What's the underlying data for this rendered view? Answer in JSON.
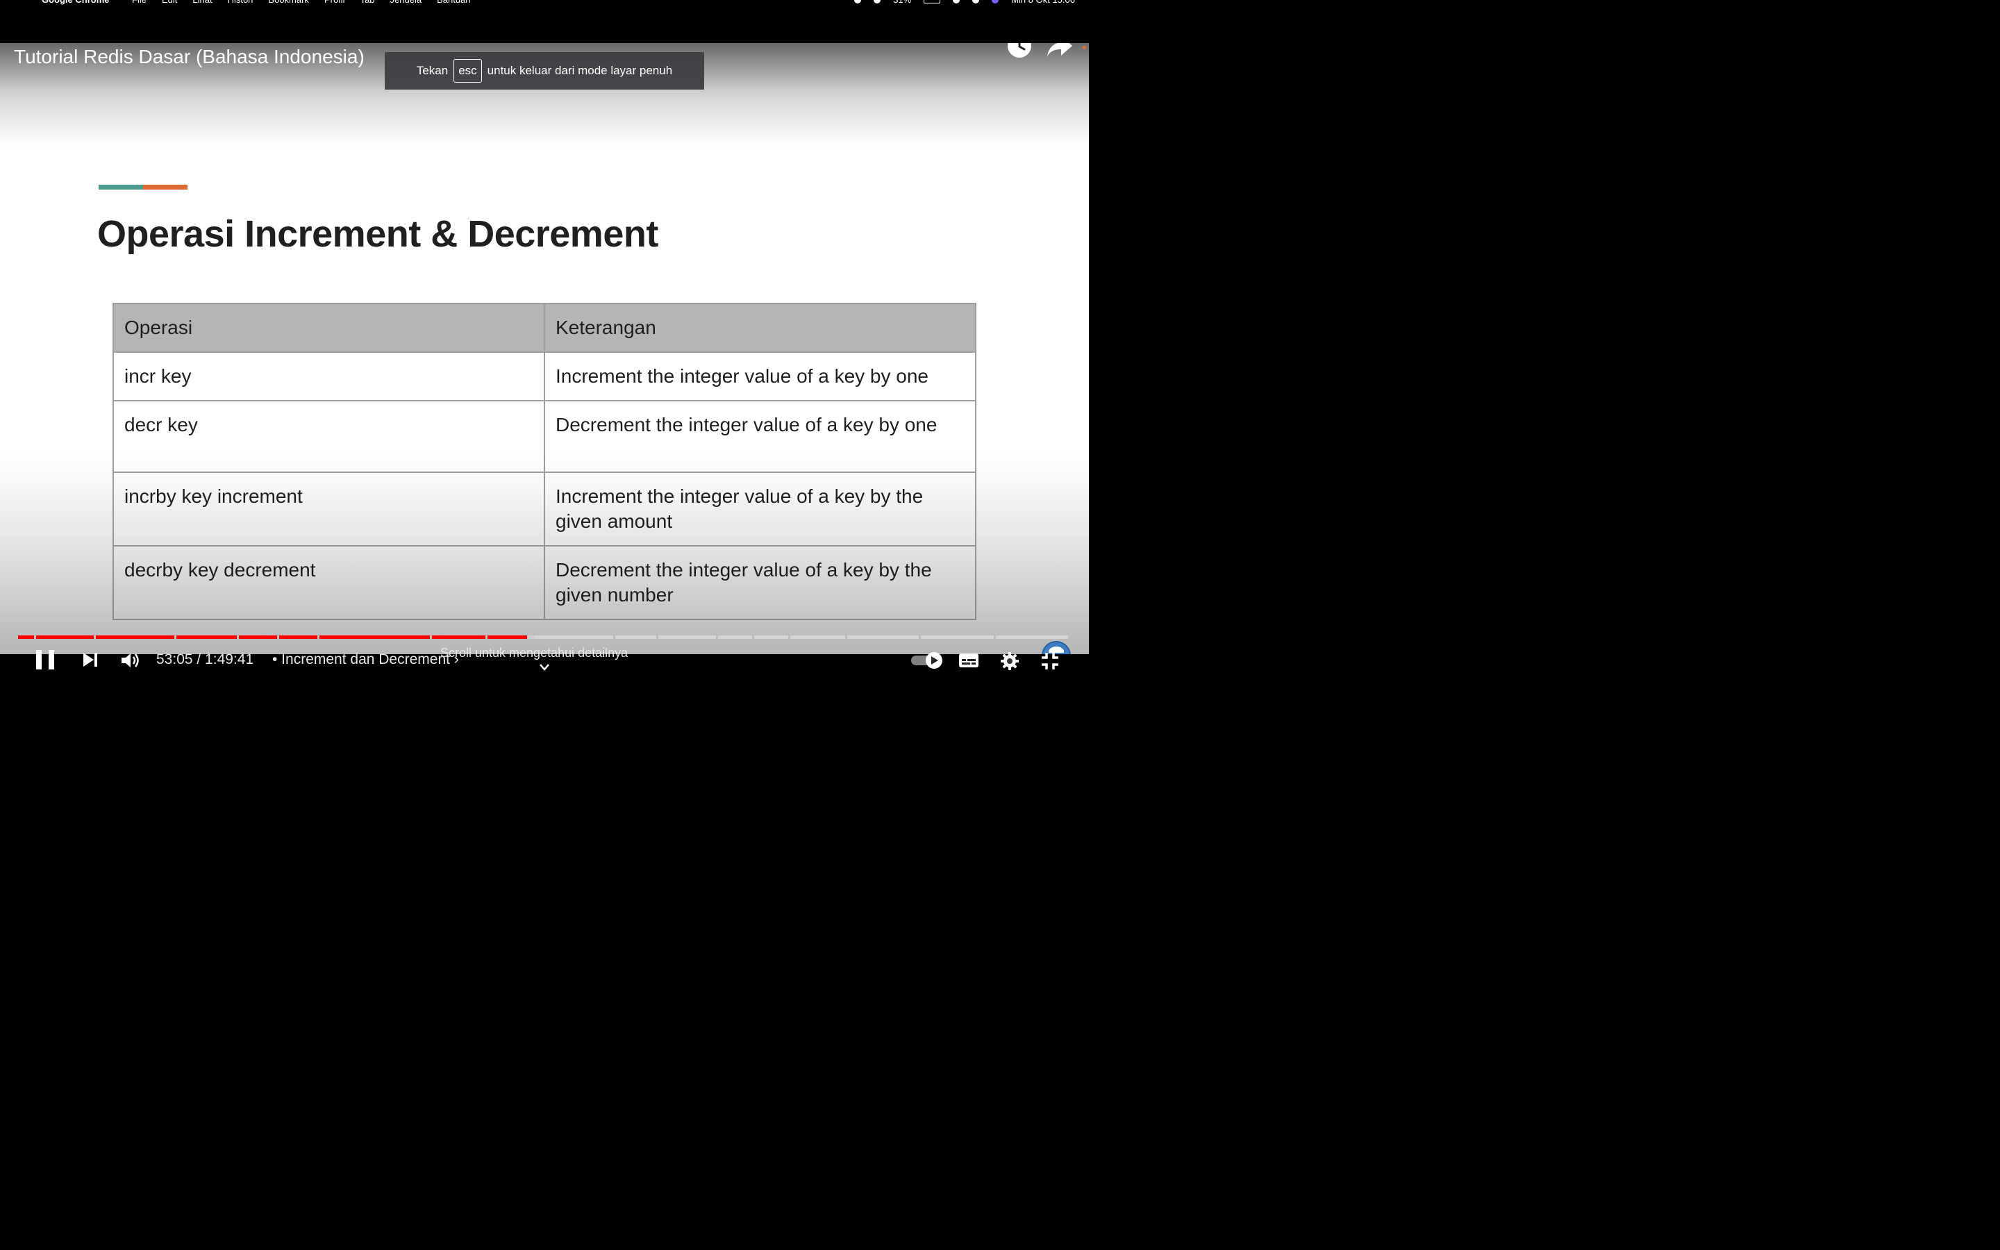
{
  "menubar": {
    "app_name": "Google Chrome",
    "items": [
      "File",
      "Edit",
      "Lihat",
      "Histori",
      "Bookmark",
      "Profil",
      "Tab",
      "Jendela",
      "Bantuan"
    ],
    "battery": "31%",
    "datetime": "Min 8 Okt  15:06"
  },
  "video": {
    "title": "Tutorial Redis Dasar (Bahasa Indonesia)"
  },
  "toast": {
    "prefix": "Tekan",
    "key": "esc",
    "suffix": "untuk keluar dari mode layar penuh"
  },
  "slide": {
    "accent_colors": [
      "#4b9b8e",
      "#e06a34"
    ],
    "title": "Operasi Increment & Decrement",
    "table": {
      "headers": [
        "Operasi",
        "Keterangan"
      ],
      "rows": [
        [
          "incr key",
          "Increment the integer value of a key by one"
        ],
        [
          "decr key",
          "Decrement the integer value of a key by one"
        ],
        [
          "incrby key increment",
          "Increment the integer value of a key by the given amount"
        ],
        [
          "decrby key decrement",
          "Decrement the integer value of a key by the given number"
        ]
      ]
    }
  },
  "player": {
    "time_display": "53:05 / 1:49:41",
    "chapter": "• Increment dan Decrement ›",
    "scroll_hint": "Scroll untuk mengetahui detailnya",
    "progress_played_fraction": 0.484,
    "played_color": "#ff0000",
    "icons": [
      "pause-icon",
      "next-icon",
      "volume-icon",
      "autoplay-toggle-icon",
      "captions-icon",
      "settings-icon",
      "exit-fullscreen-icon",
      "watch-later-icon",
      "share-icon"
    ]
  }
}
